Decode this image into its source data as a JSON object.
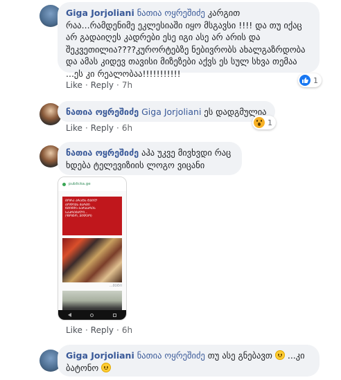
{
  "comments": [
    {
      "author": "Giga Jorjoliani",
      "mention": "ნათია ოყრეშიძე",
      "text_1": " კარგით რაა...რამდენიმე ეკლესიაში იყო მსგავსი !!!! და თუ იქაც არ გადაიღეს კადრები ესე იგი ასე არ არის და შეკვეთილია????კურორტებზე ნებივრობს ახალგაზრდობა და ამას კიდევ თავისი მიზეზები აქვს ეს სულ სხვა თემაა ...ეს კი რეალობაა!!!!!!!!!!!",
      "like": "Like",
      "reply": "Reply",
      "time": "7h",
      "reaction_count": "1",
      "reaction": "like-icon"
    },
    {
      "author": "ნათია ოყრეშიძე",
      "mention": "Giga Jorjoliani",
      "text_1": " ეს დადგმულია",
      "like": "Like",
      "reply": "Reply",
      "time": "6h",
      "reaction_count": "1",
      "reaction": "wow-icon"
    },
    {
      "author": "ნათია ოყრეშიძე",
      "text_1": " აჰა უკვე მივხვდი რაც ხდება ტელევიზიის ლოგო ვიცანი",
      "like": "Like",
      "reply": "Reply",
      "time": "6h",
      "attachment": {
        "url": "publicka.ge",
        "headline_lines": [
          "ᲛᲝᲠᲐ ᲐᲠᲐᲢᲡ ᲢᲕᲘᲚ",
          "ᲑᲝᲓᲘᲕᲡ ᲛᲐᲠᲨᲘ",
          "ᲬᲛᲘᲜᲓᲐ ᲑᲐᲠᲑᲐᲠᲔᲡ",
          "ᲡᲐᲙᲠᲔᲛᲐᲚᲘ...",
          "(ᲤᲝᲢᲝ, ᲕᲘᲓᲔᲝ)"
        ],
        "more": "...ᲛᲔᲢᲘ"
      }
    },
    {
      "author": "Giga Jorjoliani",
      "mention": "ნათია ოყრეშიძე",
      "text_1": " თუ ასე გნებავთ ",
      "text_2": " ...კი ბატონო "
    }
  ],
  "colors": {
    "link": "#385898",
    "bubble": "#f0f2f5",
    "meta": "#65676b",
    "like_blue": "#1877f2"
  }
}
